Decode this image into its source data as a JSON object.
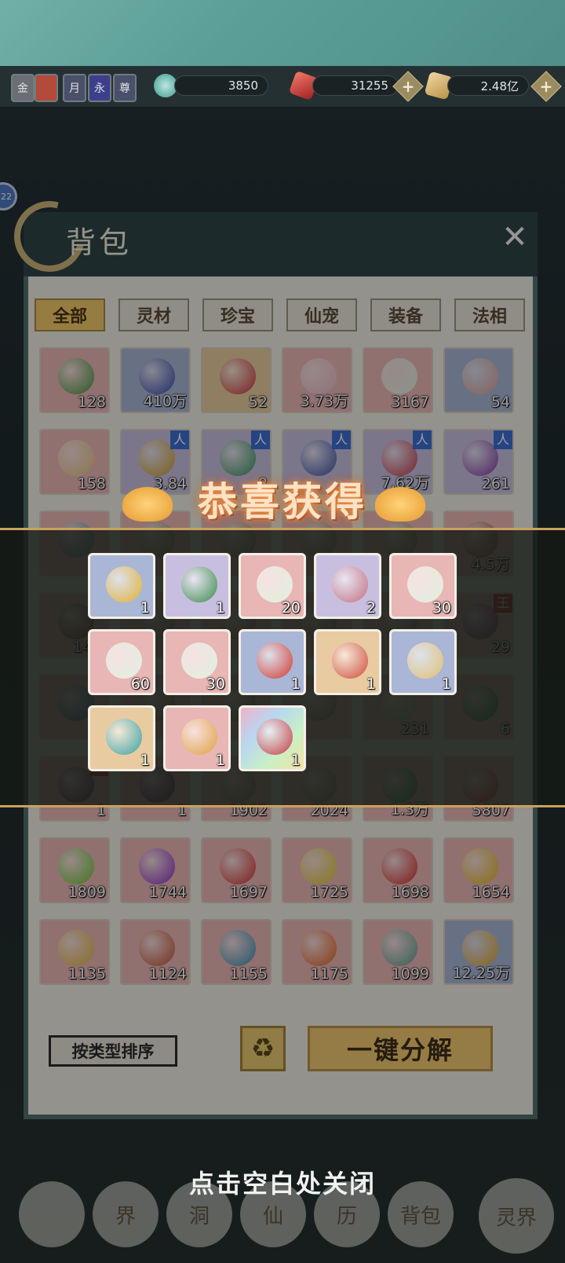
{
  "currencies": {
    "tags": [
      "金",
      "",
      "月",
      "永",
      "尊"
    ],
    "jade": "3850",
    "crystal": "31255",
    "scroll": "2.48亿"
  },
  "left_badge": "22",
  "panel": {
    "title": "背包",
    "close": "✕",
    "tabs": [
      "全部",
      "灵材",
      "珍宝",
      "仙宠",
      "装备",
      "法相"
    ],
    "active_tab": "全部"
  },
  "inventory": [
    {
      "count": "128",
      "bg": "pink",
      "color": "#4a8f3c"
    },
    {
      "count": "410万",
      "bg": "blue",
      "color": "#3a47a6"
    },
    {
      "count": "52",
      "bg": "gold",
      "color": "#c8333a"
    },
    {
      "count": "3.73万",
      "bg": "pink",
      "color": "#e7b8c6"
    },
    {
      "count": "3167",
      "bg": "pink",
      "color": "#dff0e0"
    },
    {
      "count": "54",
      "bg": "blue",
      "color": "#d79f97"
    },
    {
      "count": "158",
      "bg": "pink",
      "color": "#e2c080",
      "tag": ""
    },
    {
      "count": "3.84",
      "bg": "purp",
      "color": "#c99a2a",
      "tag": "人"
    },
    {
      "count": "8",
      "bg": "purp",
      "color": "#3b8f5a",
      "tag": "人"
    },
    {
      "count": "",
      "bg": "purp",
      "color": "#3a4fa0",
      "tag": "人"
    },
    {
      "count": "7.62万",
      "bg": "purp",
      "color": "#c23a4a",
      "tag": "人"
    },
    {
      "count": "261",
      "bg": "purp",
      "color": "#7a3aa0",
      "tag": "人"
    },
    {
      "count": "6",
      "bg": "pink",
      "color": "#6a8fa0"
    },
    {
      "count": "",
      "bg": "pink",
      "color": "#9a8a6a"
    },
    {
      "count": "",
      "bg": "pink",
      "color": "#9a8a6a"
    },
    {
      "count": "",
      "bg": "pink",
      "color": "#9a8a6a"
    },
    {
      "count": "",
      "bg": "pink",
      "color": "#9a8a6a"
    },
    {
      "count": "4.5万",
      "bg": "pink",
      "color": "#a0503a"
    },
    {
      "count": "14.6",
      "bg": "pink",
      "color": "#7a4a2a"
    },
    {
      "count": "",
      "bg": "pink",
      "color": "#9a8a6a"
    },
    {
      "count": "",
      "bg": "pink",
      "color": "#9a8a6a"
    },
    {
      "count": "",
      "bg": "pink",
      "color": "#9a8a6a"
    },
    {
      "count": "",
      "bg": "pink",
      "color": "#9a8a6a"
    },
    {
      "count": "29",
      "bg": "pink",
      "color": "#8a3a7a",
      "tag": "王"
    },
    {
      "count": "",
      "bg": "pink",
      "color": "#4a7a9a"
    },
    {
      "count": "",
      "bg": "pink",
      "color": "#9a8a6a"
    },
    {
      "count": "",
      "bg": "pink",
      "color": "#9a8a6a"
    },
    {
      "count": "",
      "bg": "pink",
      "color": "#9a8a6a"
    },
    {
      "count": "231",
      "bg": "pink",
      "color": "#9ac07a"
    },
    {
      "count": "6",
      "bg": "pink",
      "color": "#3a9a4a"
    },
    {
      "count": "1",
      "bg": "pink",
      "color": "#7a2a6a",
      "tag": "天"
    },
    {
      "count": "1",
      "bg": "pink",
      "color": "#7a2a6a"
    },
    {
      "count": "1902",
      "bg": "pink",
      "color": "#9a8a6a"
    },
    {
      "count": "2024",
      "bg": "pink",
      "color": "#9a8a6a"
    },
    {
      "count": "1.3万",
      "bg": "pink",
      "color": "#4aa04a"
    },
    {
      "count": "5807",
      "bg": "pink",
      "color": "#e05030"
    },
    {
      "count": "1809",
      "bg": "pink",
      "color": "#6ac030"
    },
    {
      "count": "1744",
      "bg": "pink",
      "color": "#8a30c0"
    },
    {
      "count": "1697",
      "bg": "pink",
      "color": "#d03030"
    },
    {
      "count": "1725",
      "bg": "pink",
      "color": "#e0c030"
    },
    {
      "count": "1698",
      "bg": "pink",
      "color": "#d02a2a"
    },
    {
      "count": "1654",
      "bg": "pink",
      "color": "#e0b020"
    },
    {
      "count": "1135",
      "bg": "pink",
      "color": "#e0b040"
    },
    {
      "count": "1124",
      "bg": "pink",
      "color": "#c05030"
    },
    {
      "count": "1155",
      "bg": "pink",
      "color": "#3a8ab0"
    },
    {
      "count": "1175",
      "bg": "pink",
      "color": "#e06020"
    },
    {
      "count": "1099",
      "bg": "pink",
      "color": "#5a9a8a"
    },
    {
      "count": "12.25万",
      "bg": "blue",
      "color": "#e0a030"
    }
  ],
  "buttons": {
    "sort": "按类型排序",
    "recycle": "♻",
    "decompose": "一键分解"
  },
  "reward": {
    "title": "恭喜获得",
    "items": [
      {
        "count": "1",
        "bg": "blue",
        "color": "#e0b030"
      },
      {
        "count": "1",
        "bg": "purp",
        "color": "#3a8a4a"
      },
      {
        "count": "20",
        "bg": "pink",
        "color": "#dff0e0"
      },
      {
        "count": "2",
        "bg": "purp",
        "color": "#c07080"
      },
      {
        "count": "30",
        "bg": "pink",
        "color": "#dff0e0"
      },
      {
        "count": "60",
        "bg": "pink",
        "color": "#dff0e0"
      },
      {
        "count": "30",
        "bg": "pink",
        "color": "#dff0e0"
      },
      {
        "count": "1",
        "bg": "blue",
        "color": "#d03a30"
      },
      {
        "count": "1",
        "bg": "gold",
        "color": "#d04a3a"
      },
      {
        "count": "1",
        "bg": "blue",
        "color": "#e0c070"
      },
      {
        "count": "1",
        "bg": "gold",
        "color": "#3aa0a0"
      },
      {
        "count": "1",
        "bg": "pink",
        "color": "#e0a040"
      },
      {
        "count": "1",
        "bg": "rainbow",
        "color": "#c03a4a"
      }
    ]
  },
  "close_hint": "点击空白处关闭",
  "bottom_nav": [
    "",
    "界",
    "洞",
    "仙",
    "历",
    "背包",
    "灵界"
  ]
}
